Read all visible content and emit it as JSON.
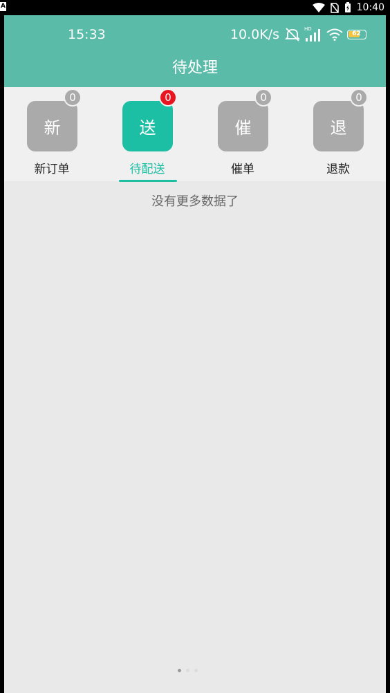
{
  "device_status": {
    "left_badge": "A",
    "time": "10:40"
  },
  "app_status": {
    "time": "15:33",
    "net_speed": "10.0K/s",
    "signal_label": "HD",
    "battery": "62"
  },
  "header": {
    "title": "待处理"
  },
  "tabs": [
    {
      "icon_char": "新",
      "label": "新订单",
      "badge": "0",
      "active": false
    },
    {
      "icon_char": "送",
      "label": "待配送",
      "badge": "0",
      "active": true
    },
    {
      "icon_char": "催",
      "label": "催单",
      "badge": "0",
      "active": false
    },
    {
      "icon_char": "退",
      "label": "退款",
      "badge": "0",
      "active": false
    }
  ],
  "content": {
    "empty_message": "没有更多数据了"
  },
  "colors": {
    "header_bg": "#5abba8",
    "accent": "#1cbfa4",
    "badge_active": "#e8141f",
    "tab_inactive": "#aaaaaa"
  }
}
